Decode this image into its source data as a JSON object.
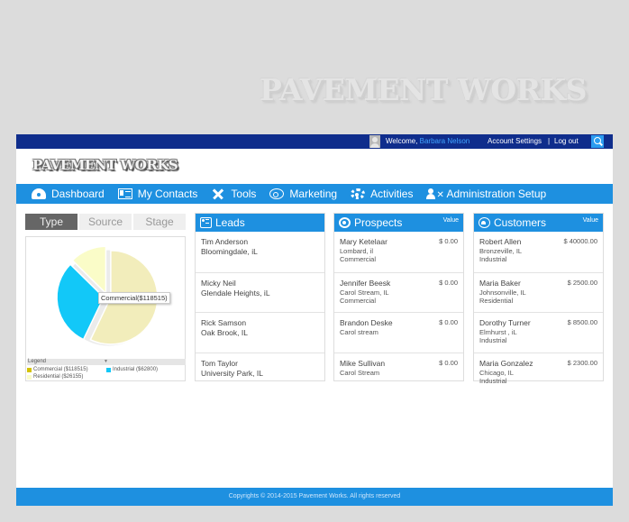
{
  "background_logo": "PAVEMENT WORKS",
  "topbar": {
    "welcome_prefix": "Welcome, ",
    "user_name": "Barbara Nelson",
    "account_settings": "Account Settings",
    "separator": "|",
    "logout": "Log out",
    "search_icon": "search-icon"
  },
  "brand": {
    "logo_text": "PAVEMENT WORKS"
  },
  "nav": [
    {
      "label": "Dashboard",
      "icon": "dashboard-icon"
    },
    {
      "label": "My Contacts",
      "icon": "contacts-icon"
    },
    {
      "label": "Tools",
      "icon": "tools-icon"
    },
    {
      "label": "Marketing",
      "icon": "marketing-icon"
    },
    {
      "label": "Activities",
      "icon": "gear-icon"
    },
    {
      "label": "Administration Setup",
      "icon": "admin-icon"
    }
  ],
  "chart_tabs": [
    {
      "label": "Type",
      "active": true
    },
    {
      "label": "Source",
      "active": false
    },
    {
      "label": "Stage",
      "active": false
    }
  ],
  "chart_data": {
    "type": "pie",
    "title": "",
    "categories": [
      "Commercial",
      "Industrial",
      "Residential"
    ],
    "values": [
      118515,
      62800,
      26155
    ],
    "colors": [
      "#f2edbb",
      "#12c8f8",
      "#fafcc8"
    ],
    "tooltip": "Commercial($118515)",
    "legend_title": "Legend",
    "legend": [
      "Commercial ($118515)",
      "Industrial ($62800)",
      "Residential ($26155)"
    ],
    "legend_colors": [
      "#d4c200",
      "#12c8f8",
      "#fafcc8"
    ],
    "legend_position": "bottom"
  },
  "leads": {
    "title": "Leads",
    "items": [
      {
        "name": "Tim Anderson",
        "location": "Bloomingdale, iL"
      },
      {
        "name": "Micky Neil",
        "location": "Glendale Heights, iL"
      },
      {
        "name": "Rick Samson",
        "location": "Oak Brook, IL"
      },
      {
        "name": "Tom Taylor",
        "location": "University Park, IL"
      }
    ]
  },
  "prospects": {
    "title": "Prospects",
    "value_header": "Value",
    "items": [
      {
        "name": "Mary Ketelaar",
        "location": "Lombard, il",
        "type": "Commercial",
        "value": "$ 0.00"
      },
      {
        "name": "Jennifer Beesk",
        "location": "Carol Stream, IL",
        "type": "Commercial",
        "value": "$ 0.00"
      },
      {
        "name": "Brandon Deske",
        "location": "Carol stream",
        "type": "",
        "value": "$ 0.00"
      },
      {
        "name": "Mike Sullivan",
        "location": "Carol Stream",
        "type": "",
        "value": "$ 0.00"
      }
    ]
  },
  "customers": {
    "title": "Customers",
    "value_header": "Value",
    "items": [
      {
        "name": "Robert Allen",
        "location": "Bronzeville, IL",
        "type": "Industrial",
        "value": "$ 40000.00"
      },
      {
        "name": "Maria Baker",
        "location": "Johnsonville, IL",
        "type": "Residential",
        "value": "$ 2500.00"
      },
      {
        "name": "Dorothy Turner",
        "location": "Elmhurst , iL",
        "type": "Industrial",
        "value": "$ 8500.00"
      },
      {
        "name": "Maria Gonzalez",
        "location": "Chicago, IL",
        "type": "Industrial",
        "value": "$ 2300.00"
      }
    ]
  },
  "footer": {
    "text": "Copyrights © 2014-2015 Pavement Works. All rights reserved"
  },
  "colors": {
    "topbar": "#0f2d8c",
    "accent": "#1e90e0",
    "link": "#41a3ff"
  }
}
